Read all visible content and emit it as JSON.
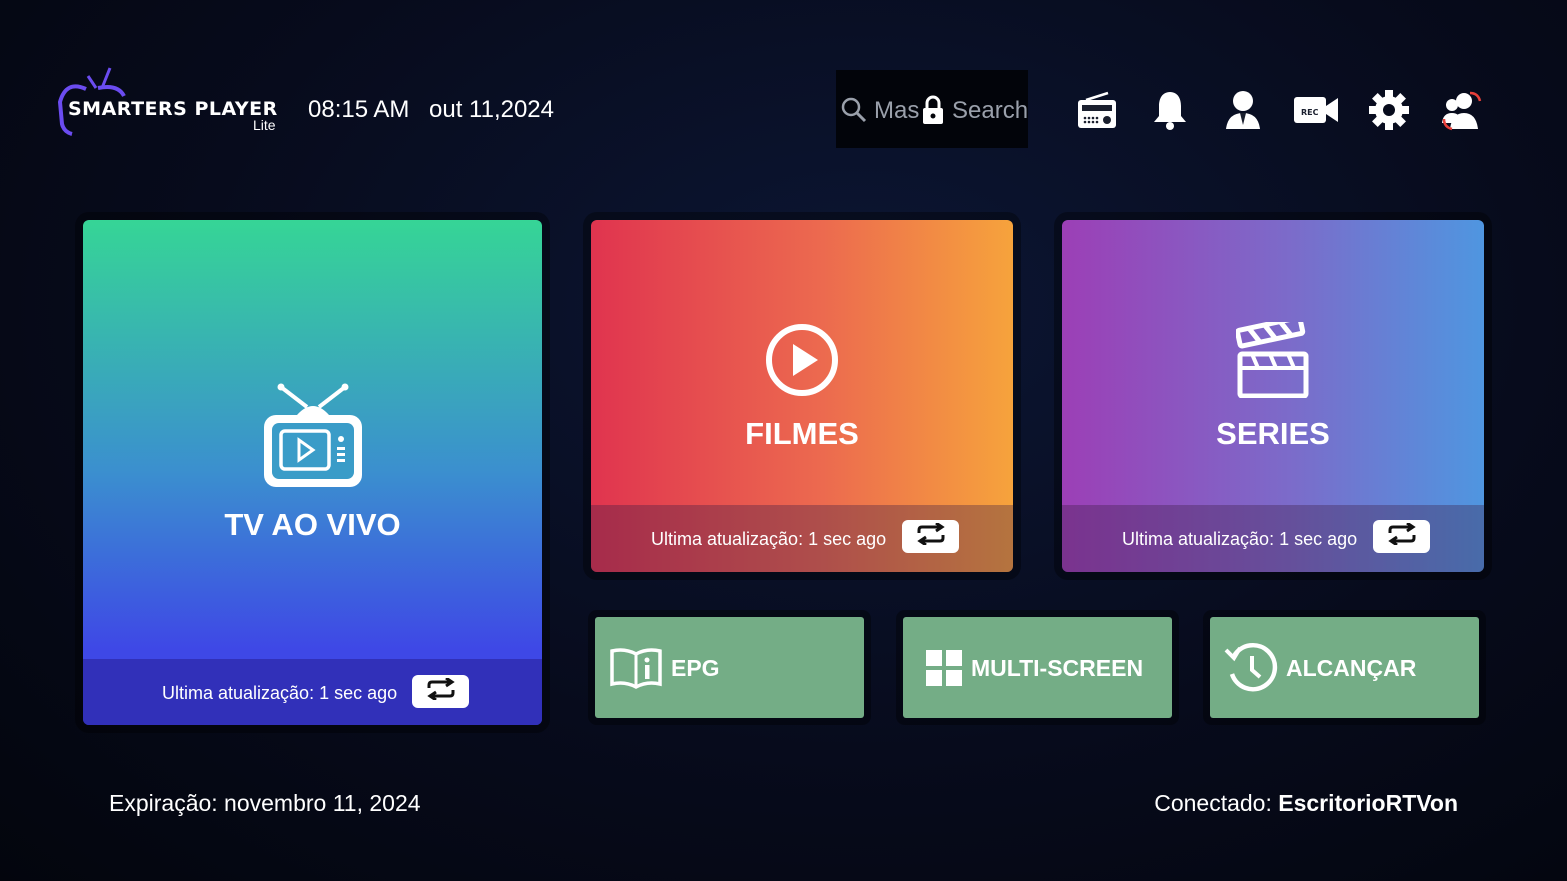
{
  "header": {
    "logo_title": "SMARTERS PLAYER",
    "logo_subtitle": "Lite",
    "time": "08:15 AM",
    "date": "out 11,2024",
    "search": {
      "placeholder_left": "Mas",
      "placeholder_right": "Search"
    },
    "icons": [
      "radio-icon",
      "bell-icon",
      "user-icon",
      "record-icon",
      "gear-icon",
      "switch-user-icon"
    ]
  },
  "tiles": {
    "live": {
      "label": "TV AO VIVO",
      "update_text": "Ultima atualização: 1 sec ago",
      "icon": "tv-icon"
    },
    "movies": {
      "label": "FILMES",
      "update_text": "Ultima atualização: 1 sec ago",
      "icon": "play-circle-icon"
    },
    "series": {
      "label": "SERIES",
      "update_text": "Ultima atualização: 1 sec ago",
      "icon": "clapperboard-icon"
    }
  },
  "small_tiles": [
    {
      "label": "EPG",
      "icon": "book-info-icon"
    },
    {
      "label": "MULTI-SCREEN",
      "icon": "grid-icon"
    },
    {
      "label": "ALCANÇAR",
      "icon": "history-icon"
    }
  ],
  "footer": {
    "expiration": "Expiração: novembro 11, 2024",
    "connected_label": "Conectado:",
    "connected_user": "EscritorioRTVon"
  },
  "colors": {
    "live_top": "#36d596",
    "live_bottom": "#3e48e6",
    "movies_left": "#e0344f",
    "movies_right": "#f6a33c",
    "series_left": "#9c3fb6",
    "series_right": "#4f96e0",
    "small_tile": "#74ad86",
    "logo_accent": "#6b4cf0"
  }
}
